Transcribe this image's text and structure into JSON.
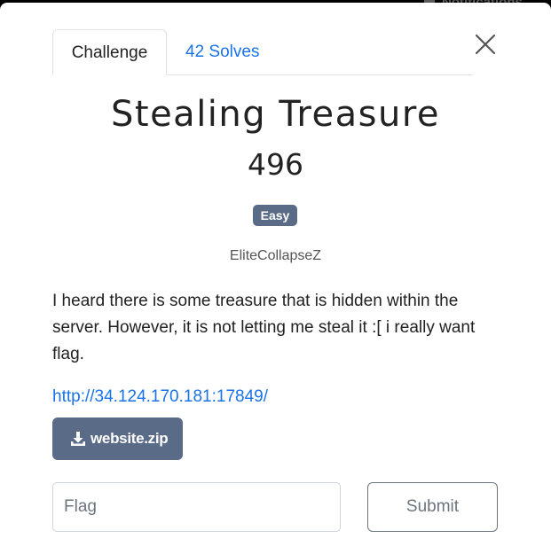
{
  "background_hint": {
    "notifications_label": "Notifications"
  },
  "modal": {
    "tabs": [
      {
        "label": "Challenge",
        "active": true
      },
      {
        "label": "42 Solves",
        "active": false
      }
    ],
    "close_icon": "close-icon",
    "challenge": {
      "name": "Stealing Treasure",
      "points": "496",
      "difficulty": "Easy",
      "author": "EliteCollapseZ",
      "description": "I heard there is some treasure that is hidden within the server. However, it is not letting me steal it :[ i really want flag.",
      "connection_url": "http://34.124.170.181:17849/",
      "file": {
        "icon": "download-icon",
        "label": "website.zip"
      }
    },
    "flag_form": {
      "placeholder": "Flag",
      "value": "",
      "submit_label": "Submit"
    }
  },
  "colors": {
    "badge": "#5a6b87",
    "link": "#1a73e8",
    "download_button": "#5a6b87"
  }
}
